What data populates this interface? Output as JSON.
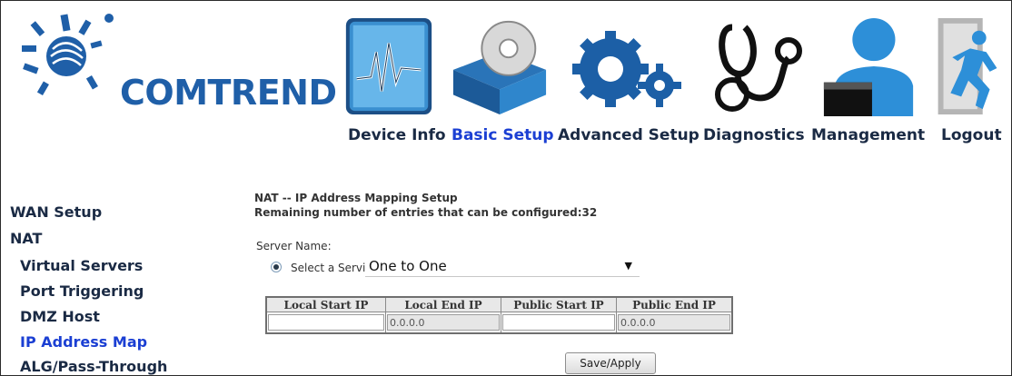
{
  "brand": {
    "name": "COMTREND",
    "color": "#1f5fa8"
  },
  "nav": {
    "items": [
      {
        "label": "Device Info",
        "icon": "device-info-icon"
      },
      {
        "label": "Basic Setup",
        "icon": "basic-setup-icon",
        "active": true
      },
      {
        "label": "Advanced Setup",
        "icon": "advanced-setup-icon"
      },
      {
        "label": "Diagnostics",
        "icon": "diagnostics-icon"
      },
      {
        "label": "Management",
        "icon": "management-icon"
      },
      {
        "label": "Logout",
        "icon": "logout-icon"
      }
    ]
  },
  "sidebar": {
    "items": [
      {
        "label": "WAN Setup"
      },
      {
        "label": "NAT"
      },
      {
        "label": "Virtual Servers"
      },
      {
        "label": "Port Triggering"
      },
      {
        "label": "DMZ Host"
      },
      {
        "label": "IP Address Map",
        "active": true
      },
      {
        "label": "ALG/Pass-Through"
      }
    ]
  },
  "main": {
    "title": "NAT -- IP Address Mapping Setup",
    "remaining": "Remaining number of entries that can be configured:32",
    "server_name_label": "Server Name:",
    "select_service_label": "Select a Service:",
    "service_value": "One to One",
    "table": {
      "headers": [
        "Local Start IP",
        "Local End IP",
        "Public Start IP",
        "Public End IP"
      ],
      "row": [
        "",
        "0.0.0.0",
        "",
        "0.0.0.0"
      ]
    },
    "save_label": "Save/Apply"
  },
  "colors": {
    "active_link": "#1b3fd3",
    "text": "#1a2a44"
  }
}
